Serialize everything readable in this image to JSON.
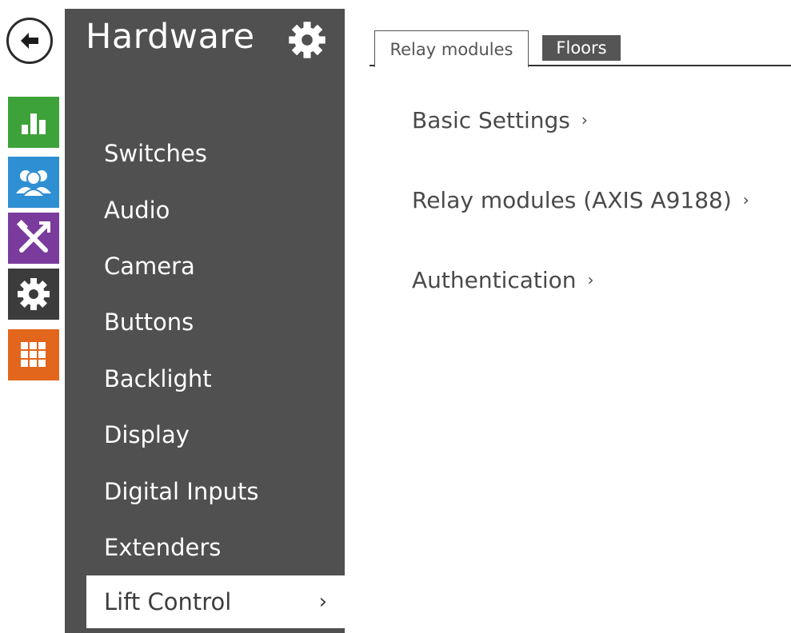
{
  "rail": {
    "back_icon": "back-arrow-icon",
    "tiles": [
      {
        "icon": "bar-chart-icon",
        "color": "#3ea23a"
      },
      {
        "icon": "users-icon",
        "color": "#2f8fd3"
      },
      {
        "icon": "tools-icon",
        "color": "#7a3b9c"
      },
      {
        "icon": "gear-icon",
        "color": "#3c3c3c"
      },
      {
        "icon": "grid-icon",
        "color": "#e2661c"
      }
    ]
  },
  "sidebar": {
    "title": "Hardware",
    "gear_icon": "gear-icon",
    "items": [
      {
        "label": "Switches"
      },
      {
        "label": "Audio"
      },
      {
        "label": "Camera"
      },
      {
        "label": "Buttons"
      },
      {
        "label": "Backlight"
      },
      {
        "label": "Display"
      },
      {
        "label": "Digital Inputs"
      },
      {
        "label": "Extenders"
      },
      {
        "label": "Lift Control",
        "chevron": "›"
      }
    ]
  },
  "main": {
    "tabs": [
      {
        "label": "Relay modules"
      },
      {
        "label": "Floors"
      }
    ],
    "sections": [
      {
        "label": "Basic Settings",
        "arrow": "›"
      },
      {
        "label": "Relay modules (AXIS A9188)",
        "arrow": "›"
      },
      {
        "label": "Authentication",
        "arrow": "›"
      }
    ]
  }
}
